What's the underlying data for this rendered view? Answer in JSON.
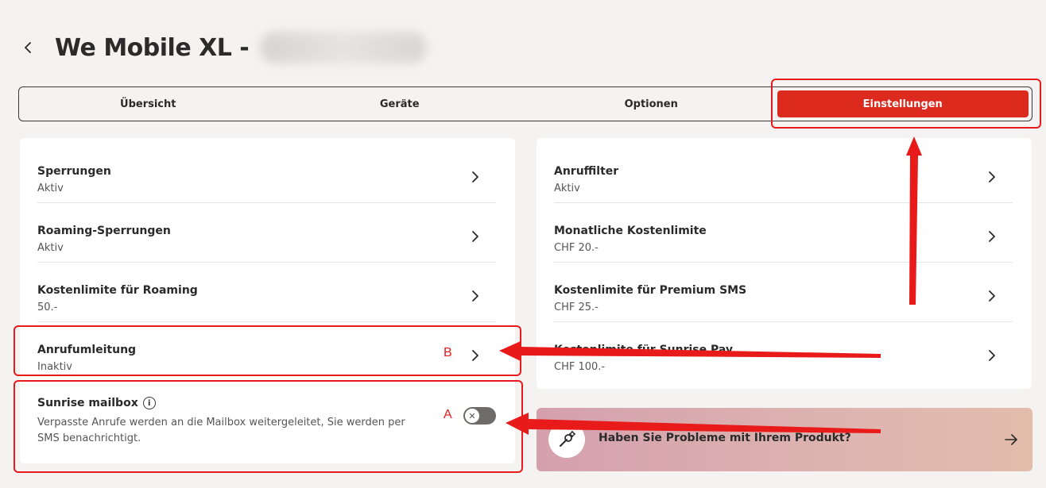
{
  "header": {
    "title": "We Mobile XL -",
    "back_icon": "chevron-left-icon"
  },
  "tabs": [
    {
      "label": "Übersicht",
      "active": false
    },
    {
      "label": "Geräte",
      "active": false
    },
    {
      "label": "Optionen",
      "active": false
    },
    {
      "label": "Einstellungen",
      "active": true
    }
  ],
  "left_settings": [
    {
      "title": "Sperrungen",
      "status": "Aktiv"
    },
    {
      "title": "Roaming-Sperrungen",
      "status": "Aktiv"
    },
    {
      "title": "Kostenlimite für Roaming",
      "status": "50.-"
    },
    {
      "title": "Anrufumleitung",
      "status": "Inaktiv"
    }
  ],
  "mailbox": {
    "title": "Sunrise mailbox",
    "info_icon": "info-icon",
    "description": "Verpasste Anrufe werden an die Mailbox weitergeleitet, Sie werden per SMS benachrichtigt.",
    "enabled": false
  },
  "right_settings": [
    {
      "title": "Anruffilter",
      "status": "Aktiv"
    },
    {
      "title": "Monatliche Kostenlimite",
      "status": "CHF 20.-"
    },
    {
      "title": "Kostenlimite für Premium SMS",
      "status": "CHF 25.-"
    },
    {
      "title": "Kostenlimite für Sunrise Pay",
      "status": "CHF 100.-"
    }
  ],
  "promo": {
    "text": "Haben Sie Probleme mit Ihrem Produkt?",
    "icon": "tools-icon",
    "arrow_icon": "arrow-right-icon"
  },
  "annotations": {
    "label_a": "A",
    "label_b": "B",
    "color": "#e81a1a"
  },
  "colors": {
    "accent": "#dd2a1f",
    "background": "#f5f3f1"
  }
}
